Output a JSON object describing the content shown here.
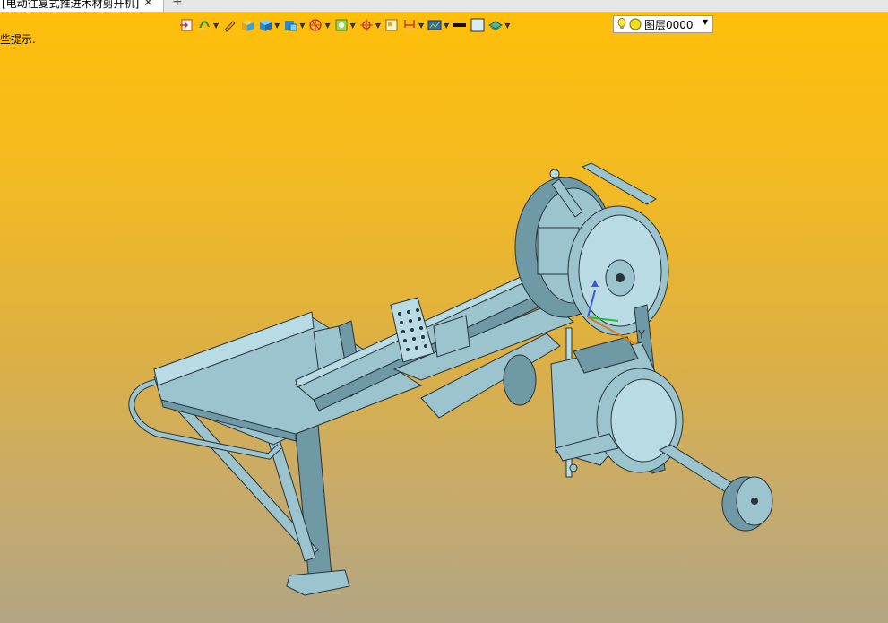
{
  "tab": {
    "title": "[电动往复式推进木材剪开机]",
    "close_glyph": "✕",
    "new_tab_glyph": "+"
  },
  "toolbar": {
    "icons": [
      "import-icon",
      "trim-icon",
      "pencil-icon",
      "box-icon",
      "cube-icon",
      "solid-view-icon",
      "render-icon",
      "shade-icon",
      "snap-icon",
      "frame-icon",
      "dimension-icon",
      "display-icon",
      "line-color-icon",
      "fill-color-icon",
      "layer-stack-icon"
    ],
    "layer": {
      "value": "图层0000",
      "bulb_color": "#ffe640",
      "dot_color": "#f2e020"
    }
  },
  "hint": "些提示.",
  "viewport": {
    "gradient_top": "#ffbe0a",
    "gradient_bottom": "#b2a583"
  },
  "triad": {
    "y_label": "Y"
  }
}
